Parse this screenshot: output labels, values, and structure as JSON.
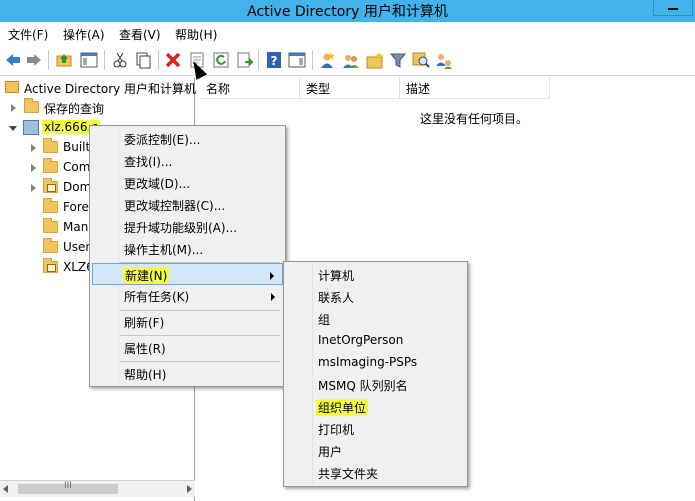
{
  "window": {
    "title": "Active Directory 用户和计算机"
  },
  "menubar": [
    {
      "label": "文件(F)"
    },
    {
      "label": "操作(A)"
    },
    {
      "label": "查看(V)"
    },
    {
      "label": "帮助(H)"
    }
  ],
  "toolbar": {
    "icons": [
      "back-arrow-icon",
      "forward-arrow-icon",
      "up-folder-icon",
      "console-tree-icon",
      "cut-icon",
      "copy-icon",
      "delete-icon",
      "properties-icon",
      "refresh-icon",
      "export-list-icon",
      "help-icon",
      "show-hide-pane-icon",
      "new-user-icon",
      "new-group-icon",
      "new-ou-icon",
      "filter-icon",
      "find-icon",
      "add-to-group-icon"
    ]
  },
  "tree": {
    "root": "Active Directory 用户和计算机",
    "saved_queries": "保存的查询",
    "domain": "xlz.666.c",
    "children": [
      "Built",
      "Com",
      "Dom",
      "Fore",
      "Man",
      "User",
      "XLZ6"
    ]
  },
  "list": {
    "columns": [
      "名称",
      "类型",
      "描述"
    ],
    "empty_message": "这里没有任何项目。"
  },
  "context_menu": {
    "items": [
      {
        "label": "委派控制(E)..."
      },
      {
        "label": "查找(I)..."
      },
      {
        "label": "更改域(D)..."
      },
      {
        "label": "更改域控制器(C)..."
      },
      {
        "label": "提升域功能级别(A)..."
      },
      {
        "label": "操作主机(M)..."
      },
      {
        "label": "新建(N)"
      },
      {
        "label": "所有任务(K)"
      },
      {
        "label": "刷新(F)"
      },
      {
        "label": "属性(R)"
      },
      {
        "label": "帮助(H)"
      }
    ]
  },
  "submenu": {
    "items": [
      {
        "label": "计算机"
      },
      {
        "label": "联系人"
      },
      {
        "label": "组"
      },
      {
        "label": "InetOrgPerson"
      },
      {
        "label": "msImaging-PSPs"
      },
      {
        "label": "MSMQ 队列别名"
      },
      {
        "label": "组织单位"
      },
      {
        "label": "打印机"
      },
      {
        "label": "用户"
      },
      {
        "label": "共享文件夹"
      }
    ]
  },
  "scrollbar": {
    "grip": "III"
  },
  "colors": {
    "titlebar": "#41b2ea",
    "highlight": "#f4ff3d",
    "menu_selected": "#d1e8fb"
  }
}
